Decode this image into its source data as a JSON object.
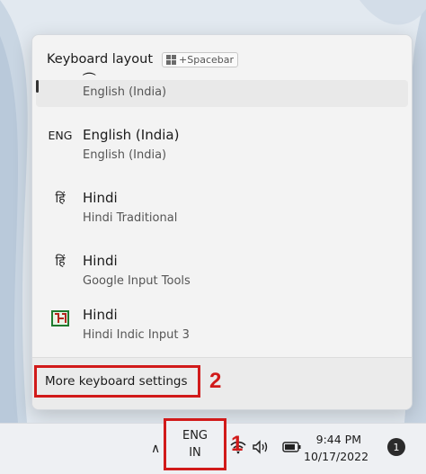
{
  "flyout": {
    "title": "Keyboard layout",
    "shortcut_plus": "+",
    "shortcut_key": "Spacebar",
    "items": [
      {
        "glyph": "",
        "name": "",
        "sub": "English (India)"
      },
      {
        "glyph": "ENG",
        "name": "English (India)",
        "sub": "English (India)"
      },
      {
        "glyph": "हिं",
        "name": "Hindi",
        "sub": "Hindi Traditional"
      },
      {
        "glyph": "हिं",
        "name": "Hindi",
        "sub": "Google Input Tools"
      },
      {
        "glyph": "",
        "name": "Hindi",
        "sub": "Hindi Indic Input 3"
      }
    ],
    "more_settings": "More keyboard settings"
  },
  "annotations": {
    "step1": "1",
    "step2": "2"
  },
  "taskbar": {
    "ime_line1": "ENG",
    "ime_line2": "IN",
    "time": "9:44 PM",
    "date": "10/17/2022",
    "notification_count": "1"
  },
  "colors": {
    "highlight": "#d11a1a",
    "flyout_bg": "#f3f3f3",
    "taskbar_bg": "#eef0f3"
  }
}
